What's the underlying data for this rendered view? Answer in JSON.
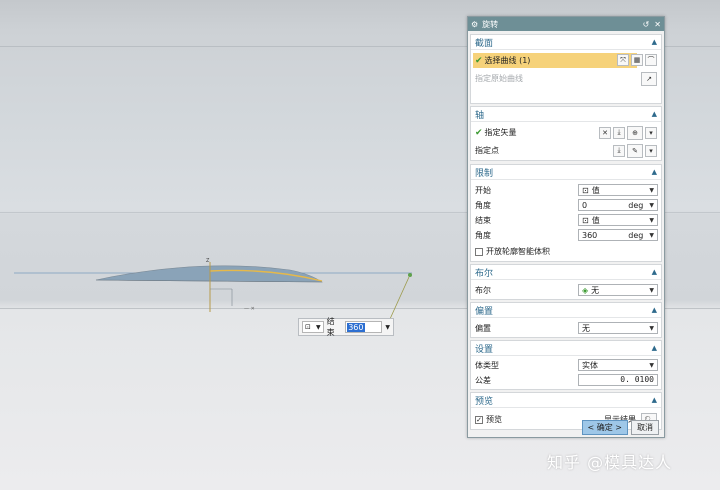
{
  "dialog": {
    "title": "旋转",
    "sections": {
      "section_face": {
        "title": "截面",
        "select_curve": "选择曲线 (1)",
        "origin_curve": "指定原始曲线"
      },
      "axis": {
        "title": "轴",
        "vector": "指定矢量",
        "point": "指定点"
      },
      "limits": {
        "title": "限制",
        "start_label": "开始",
        "start_value": "值",
        "start_angle_label": "角度",
        "start_angle": "0",
        "start_unit": "deg",
        "end_label": "结束",
        "end_value": "值",
        "end_angle_label": "角度",
        "end_angle": "360",
        "end_unit": "deg",
        "open_profile": "开放轮廓智能体积"
      },
      "boolean": {
        "title": "布尔",
        "label": "布尔",
        "value": "无"
      },
      "offset": {
        "title": "偏置",
        "label": "偏置",
        "value": "无"
      },
      "settings": {
        "title": "设置",
        "body_type_label": "体类型",
        "body_type": "实体",
        "tolerance_label": "公差",
        "tolerance": "0. 0100"
      },
      "preview": {
        "title": "预览",
        "preview_label": "预览",
        "show_result": "显示结果"
      }
    },
    "ok_label": "< 确定 >",
    "cancel_label": "取消"
  },
  "float_input": {
    "label": "结束",
    "value": "360"
  },
  "watermark": "知乎 @模具达人",
  "colors": {
    "titlebar": "#6e8f96",
    "highlight": "#f6d27a",
    "section_title": "#2e6a8c",
    "profile_curve": "#e6b94a",
    "surface": "#8aa3b8"
  }
}
